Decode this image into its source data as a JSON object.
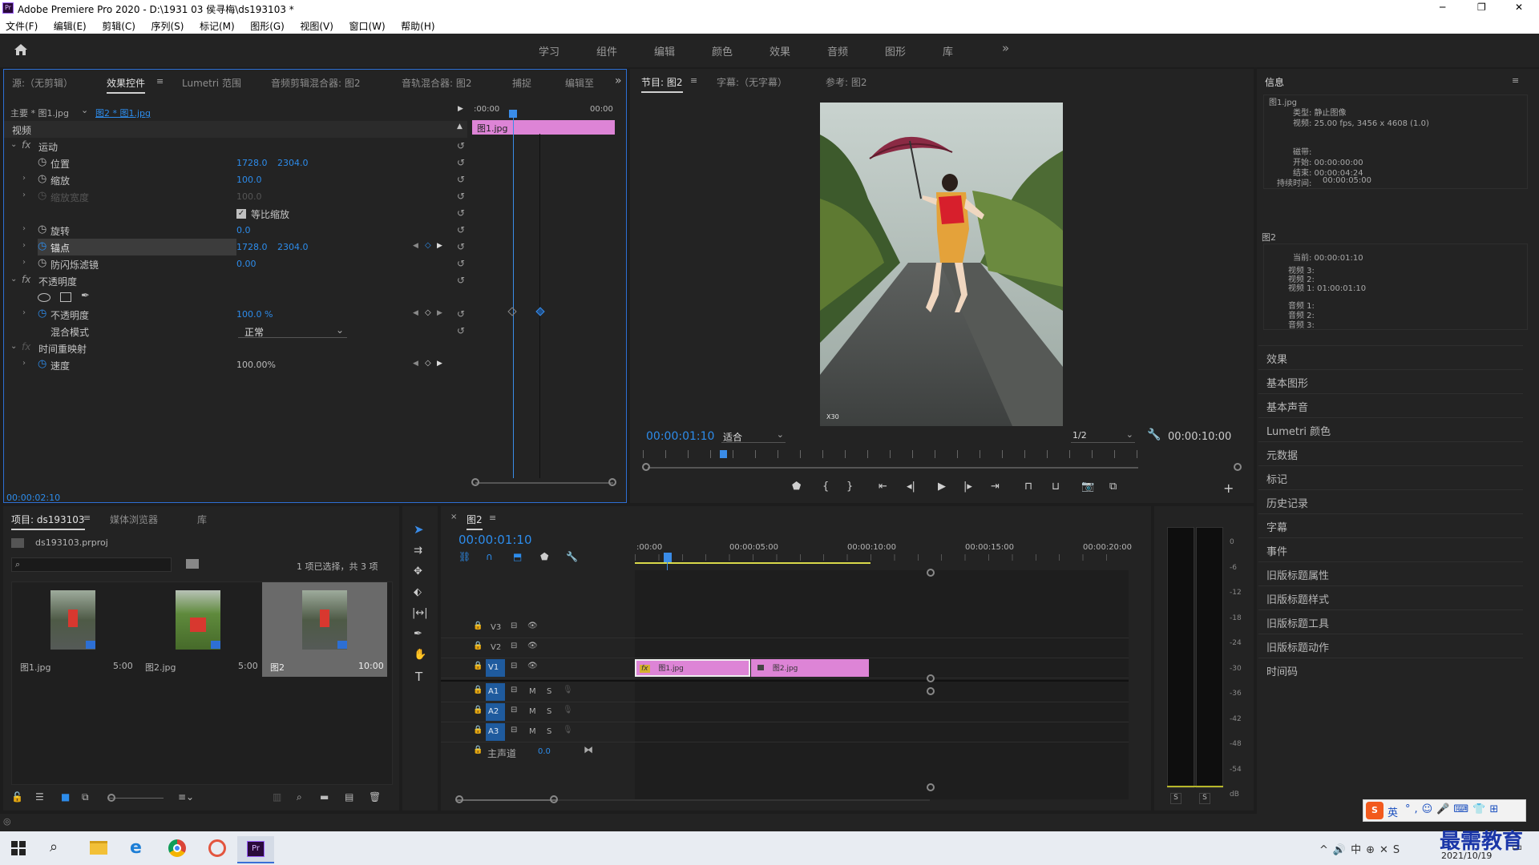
{
  "app_title": "Adobe Premiere Pro 2020 - D:\\1931 03 侯寻梅\\ds193103 *",
  "window_controls": {
    "minimize": "─",
    "restore": "❐",
    "close": "✕"
  },
  "menu": [
    "文件(F)",
    "编辑(E)",
    "剪辑(C)",
    "序列(S)",
    "标记(M)",
    "图形(G)",
    "视图(V)",
    "窗口(W)",
    "帮助(H)"
  ],
  "workspaces": [
    "学习",
    "组件",
    "编辑",
    "颜色",
    "效果",
    "音频",
    "图形",
    "库"
  ],
  "effect_panel": {
    "tabs": [
      "源:（无剪辑）",
      "效果控件",
      "Lumetri 范围",
      "音频剪辑混合器: 图2",
      "音轨混合器: 图2",
      "捕捉",
      "编辑至"
    ],
    "master_label": "主要 * 图1.jpg",
    "clip_label": "图2 * 图1.jpg",
    "ruler_start": ":00:00",
    "ruler_end": "00:00",
    "clip_bar": "图1.jpg",
    "video_header": "视频",
    "motion": "运动",
    "position_label": "位置",
    "position_x": "1728.0",
    "position_y": "2304.0",
    "scale_label": "缩放",
    "scale_value": "100.0",
    "scale_width_label": "缩放宽度",
    "scale_width_value": "100.0",
    "uniform_label": "等比缩放",
    "rotation_label": "旋转",
    "rotation_value": "0.0",
    "anchor_label": "锚点",
    "anchor_x": "1728.0",
    "anchor_y": "2304.0",
    "antiflicker_label": "防闪烁滤镜",
    "antiflicker_value": "0.00",
    "opacity_group": "不透明度",
    "opacity_label": "不透明度",
    "opacity_value": "100.0 %",
    "blend_label": "混合模式",
    "blend_value": "正常",
    "time_remap": "时间重映射",
    "speed_label": "速度",
    "speed_value": "100.00%",
    "timecode": "00:00:02:10"
  },
  "program": {
    "tabs": [
      "节目: 图2",
      "字幕:（无字幕）",
      "参考: 图2"
    ],
    "timecode": "00:00:01:10",
    "fit": "适合",
    "resolution": "1/2",
    "duration": "00:00:10:00",
    "watermark": "X30"
  },
  "info_panel": {
    "title": "信息",
    "clip_name": "图1.jpg",
    "type_line": "类型: 静止图像",
    "video_line": "视频: 25.00 fps, 3456 x 4608 (1.0)",
    "tape_label": "磁带:",
    "start_line": "开始: 00:00:00:00",
    "end_line": "结束: 00:00:04:24",
    "duration_label": "持续时间:",
    "duration_value": "00:00:05:00",
    "seq_name": "图2",
    "current_line": "当前: 00:00:01:10",
    "v3": "视频 3:",
    "v2": "视频 2:",
    "v1": "视频 1: 01:00:01:10",
    "a1": "音频 1:",
    "a2": "音频 2:",
    "a3": "音频 3:"
  },
  "right_panels": [
    "效果",
    "基本图形",
    "基本声音",
    "Lumetri 颜色",
    "元数据",
    "标记",
    "历史记录",
    "字幕",
    "事件",
    "旧版标题属性",
    "旧版标题样式",
    "旧版标题工具",
    "旧版标题动作",
    "时间码"
  ],
  "project": {
    "tabs": [
      "项目: ds193103",
      "媒体浏览器",
      "库"
    ],
    "file": "ds193103.prproj",
    "selection": "1 项已选择，共 3 项",
    "items": [
      {
        "name": "图1.jpg",
        "dur": "5:00"
      },
      {
        "name": "图2.jpg",
        "dur": "5:00"
      },
      {
        "name": "图2",
        "dur": "10:00"
      }
    ]
  },
  "timeline": {
    "tab": "图2",
    "timecode": "00:00:01:10",
    "ruler": [
      ":00:00",
      "00:00:05:00",
      "00:00:10:00",
      "00:00:15:00",
      "00:00:20:00"
    ],
    "video_tracks": [
      "V3",
      "V2",
      "V1"
    ],
    "audio_tracks": [
      "A1",
      "A2",
      "A3"
    ],
    "master": "主声道",
    "master_value": "0.0",
    "clips": [
      "图1.jpg",
      "图2.jpg"
    ],
    "m": "M",
    "s": "S"
  },
  "meter": {
    "scale": [
      "0",
      "-6",
      "-12",
      "-18",
      "-24",
      "-30",
      "-36",
      "-42",
      "-48",
      "-54",
      "dB"
    ],
    "s1": "S",
    "s2": "S"
  },
  "taskbar": {
    "time_line1": "最需教育",
    "date": "2021/10/19",
    "ime": "英"
  }
}
